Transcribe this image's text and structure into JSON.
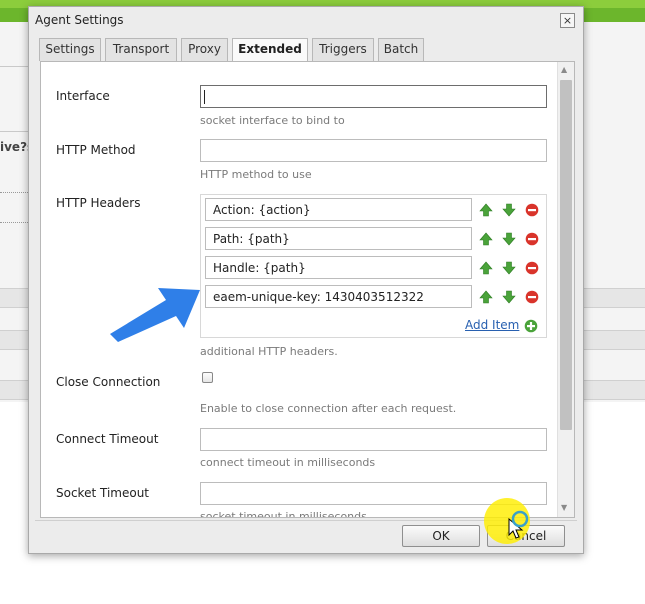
{
  "colors": {
    "accent_green": "#6cb62c",
    "link": "#2860b0",
    "annotation_arrow": "#2f7fe8",
    "highlight": "#ffee00",
    "remove_red": "#d9342b"
  },
  "background": {
    "fragment_text": "ive?s"
  },
  "dialog": {
    "title": "Agent Settings",
    "close_glyph": "×",
    "tabs": [
      {
        "label": "Settings",
        "active": false
      },
      {
        "label": "Transport",
        "active": false
      },
      {
        "label": "Proxy",
        "active": false
      },
      {
        "label": "Extended",
        "active": true
      },
      {
        "label": "Triggers",
        "active": false
      },
      {
        "label": "Batch",
        "active": false
      }
    ],
    "fields": {
      "interface": {
        "label": "Interface",
        "value": "",
        "help": "socket interface to bind to"
      },
      "http_method": {
        "label": "HTTP Method",
        "value": "",
        "help": "HTTP method to use"
      },
      "http_headers": {
        "label": "HTTP Headers",
        "items": [
          "Action: {action}",
          "Path: {path}",
          "Handle: {path}",
          "eaem-unique-key: 1430403512322"
        ],
        "add_item_label": "Add Item",
        "help": "additional HTTP headers."
      },
      "close_connection": {
        "label": "Close Connection",
        "checked": false,
        "help": "Enable to close connection after each request."
      },
      "connect_timeout": {
        "label": "Connect Timeout",
        "value": "",
        "help": "connect timeout in milliseconds"
      },
      "socket_timeout": {
        "label": "Socket Timeout",
        "value": "",
        "help": "socket timeout in milliseconds"
      }
    },
    "buttons": {
      "ok": "OK",
      "cancel": "Cancel"
    }
  }
}
